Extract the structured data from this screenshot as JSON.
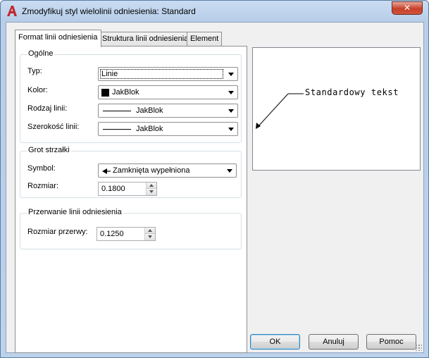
{
  "window": {
    "title": "Zmodyfikuj styl wielolinii odniesienia: Standard",
    "close_glyph": "✕",
    "app_icon": "autocad-icon"
  },
  "tabs": [
    {
      "label": "Format linii odniesienia",
      "active": true
    },
    {
      "label": "Struktura linii odniesienia",
      "active": false
    },
    {
      "label": "Element",
      "active": false
    }
  ],
  "general": {
    "title": "Ogólne",
    "type_label": "Typ:",
    "type_value": "Linie",
    "color_label": "Kolor:",
    "color_value": "JakBlok",
    "linetype_label": "Rodzaj linii:",
    "linetype_value": "JakBlok",
    "lineweight_label": "Szerokość linii:",
    "lineweight_value": "JakBlok"
  },
  "arrowhead": {
    "title": "Grot strzałki",
    "symbol_label": "Symbol:",
    "symbol_value": "Zamknięta wypełniona",
    "size_label": "Rozmiar:",
    "size_value": "0.1800"
  },
  "break": {
    "title": "Przerwanie linii odniesienia",
    "gap_label": "Rozmiar przerwy:",
    "gap_value": "0.1250"
  },
  "preview": {
    "text": "Standardowy tekst"
  },
  "buttons": {
    "ok": "OK",
    "cancel": "Anuluj",
    "help": "Pomoc"
  },
  "colors": {
    "close_button": "#c7402b",
    "swatch": "#000000",
    "app_icon": "#c1272d"
  }
}
